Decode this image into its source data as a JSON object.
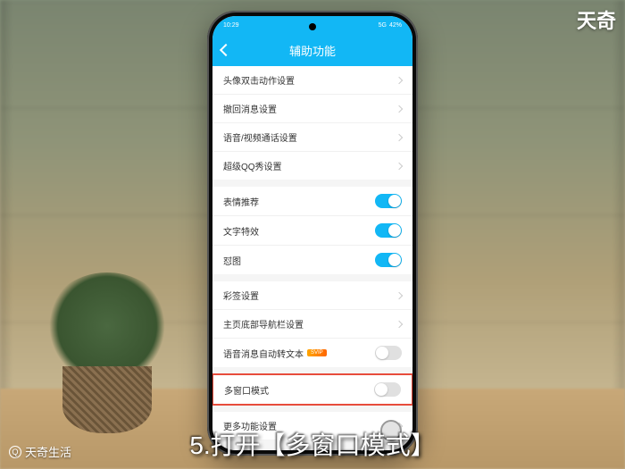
{
  "status_bar": {
    "time": "10:29",
    "battery": "42%",
    "signal": "5G"
  },
  "header": {
    "title": "辅助功能"
  },
  "groups": [
    {
      "rows": [
        {
          "label": "头像双击动作设置",
          "type": "nav"
        },
        {
          "label": "撤回消息设置",
          "type": "nav"
        },
        {
          "label": "语音/视频通话设置",
          "type": "nav"
        },
        {
          "label": "超级QQ秀设置",
          "type": "nav"
        }
      ]
    },
    {
      "rows": [
        {
          "label": "表情推荐",
          "type": "toggle",
          "on": true
        },
        {
          "label": "文字特效",
          "type": "toggle",
          "on": true
        },
        {
          "label": "怼图",
          "type": "toggle",
          "on": true
        }
      ]
    },
    {
      "rows": [
        {
          "label": "彩签设置",
          "type": "nav"
        },
        {
          "label": "主页底部导航栏设置",
          "type": "nav"
        },
        {
          "label": "语音消息自动转文本",
          "type": "toggle",
          "on": false,
          "badge": "SVIP"
        }
      ]
    },
    {
      "rows": [
        {
          "label": "多窗口模式",
          "type": "toggle",
          "on": false,
          "highlight": true
        }
      ]
    },
    {
      "rows": [
        {
          "label": "更多功能设置",
          "type": "nav"
        }
      ]
    }
  ],
  "caption": "5.打开【多窗口模式】",
  "watermark_tr": "天奇",
  "watermark_bl": "天奇生活"
}
